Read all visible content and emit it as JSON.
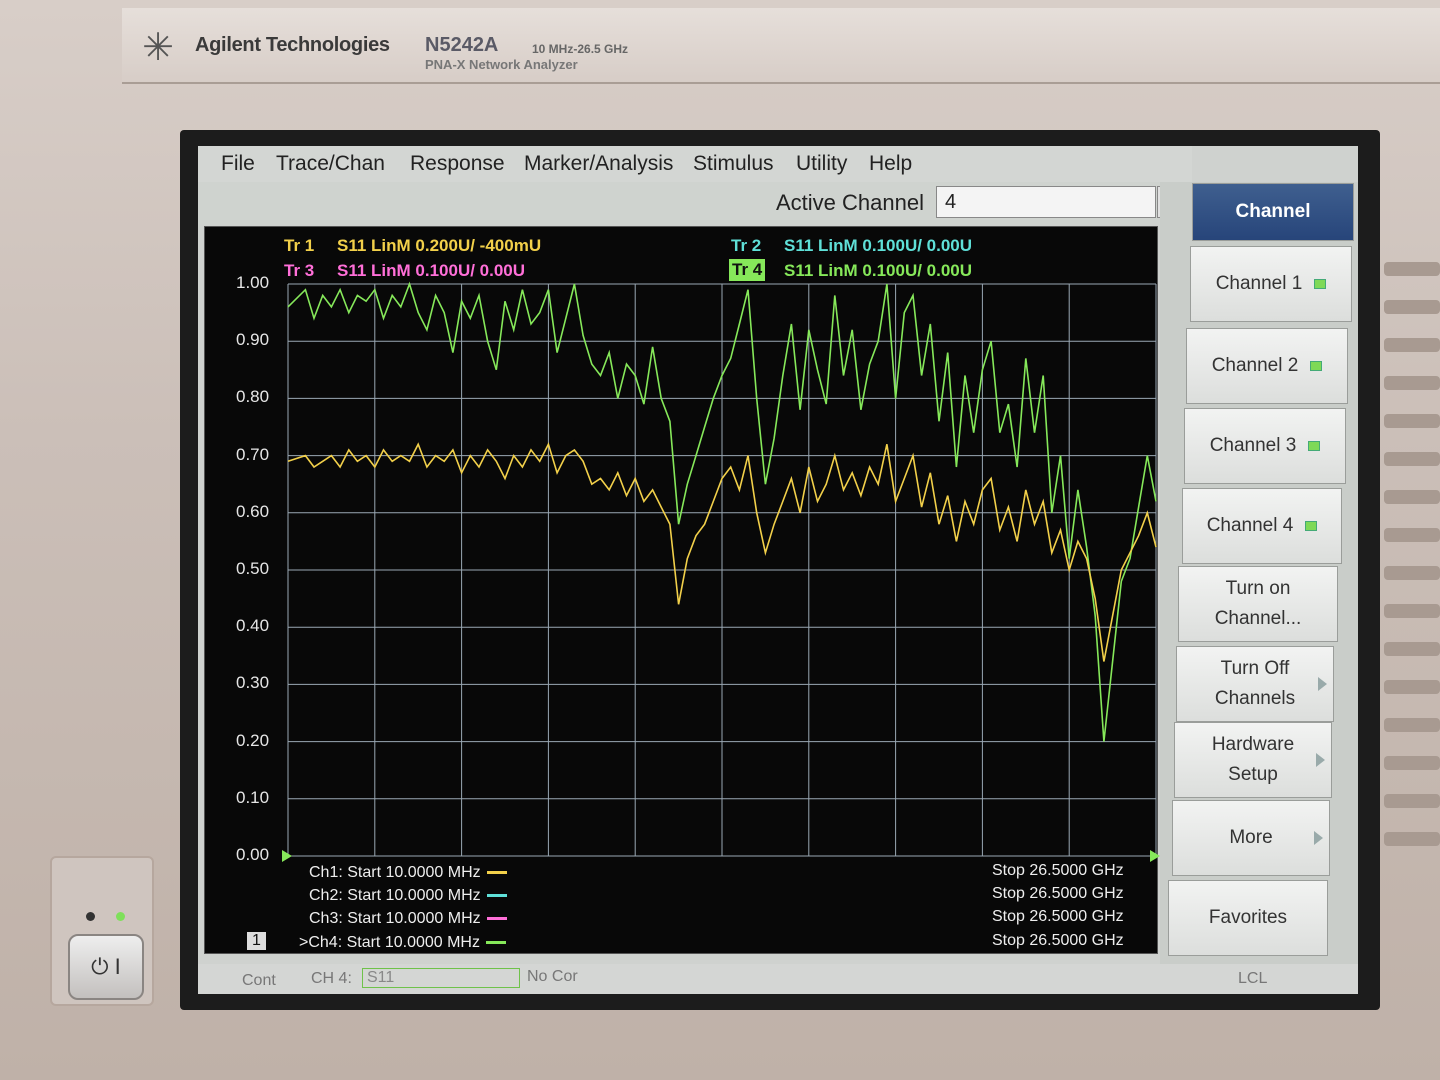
{
  "instrument": {
    "brand": "Agilent Technologies",
    "model": "N5242A",
    "freq_range": "10 MHz-26.5 GHz",
    "subtitle": "PNA-X Network Analyzer"
  },
  "menu": [
    "File",
    "Trace/Chan",
    "Response",
    "Marker/Analysis",
    "Stimulus",
    "Utility",
    "Help"
  ],
  "active_channel": {
    "label": "Active Channel",
    "value": "4"
  },
  "softkeys": {
    "header": "Channel",
    "channel1": "Channel 1",
    "channel2": "Channel 2",
    "channel3": "Channel 3",
    "channel4": "Channel 4",
    "turn_on_1": "Turn on",
    "turn_on_2": "Channel...",
    "turn_off_1": "Turn Off",
    "turn_off_2": "Channels",
    "hardware_1": "Hardware",
    "hardware_2": "Setup",
    "more": "More",
    "favorites": "Favorites"
  },
  "traces": {
    "tr1_id": "Tr 1",
    "tr1_text": "S11 LinM 0.200U/  -400mU",
    "tr2_id": "Tr 2",
    "tr2_text": "S11 LinM 0.100U/  0.00U",
    "tr3_id": "Tr 3",
    "tr3_text": "S11 LinM 0.100U/  0.00U",
    "tr4_id": "Tr 4",
    "tr4_text": "S11 LinM 0.100U/  0.00U"
  },
  "channels_info": {
    "ch1_start": "Ch1: Start  10.0000 MHz",
    "ch1_stop": "Stop  26.5000 GHz",
    "ch2_start": "Ch2: Start  10.0000 MHz",
    "ch2_stop": "Stop  26.5000 GHz",
    "ch3_start": "Ch3: Start  10.0000 MHz",
    "ch3_stop": "Stop  26.5000 GHz",
    "ch4_start": ">Ch4: Start  10.0000 MHz",
    "ch4_stop": "Stop  26.5000 GHz",
    "window_num": "1"
  },
  "status": {
    "cont": "Cont",
    "ch": "CH 4:",
    "param": "S11",
    "cor": "No Cor",
    "lcl": "LCL"
  },
  "colors": {
    "tr1": "#f2d04a",
    "tr2": "#5fe0d8",
    "tr3": "#ff6fd8",
    "tr4": "#86e85a"
  },
  "chart_data": {
    "type": "line",
    "xlabel": "",
    "ylabel": "",
    "ylim": [
      0,
      1.0
    ],
    "xlim": [
      0,
      100
    ],
    "yticks": [
      "1.00",
      "0.90",
      "0.80",
      "0.70",
      "0.60",
      "0.50",
      "0.40",
      "0.30",
      "0.20",
      "0.10",
      "0.00"
    ],
    "grid": true,
    "series": [
      {
        "name": "Tr 4",
        "x": [
          0,
          2,
          3,
          4,
          5,
          6,
          7,
          8,
          9,
          10,
          11,
          12,
          13,
          14,
          15,
          16,
          17,
          18,
          19,
          20,
          21,
          22,
          23,
          24,
          25,
          26,
          27,
          28,
          29,
          30,
          31,
          32,
          33,
          34,
          35,
          36,
          37,
          38,
          39,
          40,
          41,
          42,
          43,
          44,
          45,
          46,
          47,
          48,
          49,
          50,
          51,
          52,
          53,
          54,
          55,
          56,
          57,
          58,
          59,
          60,
          61,
          62,
          63,
          64,
          65,
          66,
          67,
          68,
          69,
          70,
          71,
          72,
          73,
          74,
          75,
          76,
          77,
          78,
          79,
          80,
          81,
          82,
          83,
          84,
          85,
          86,
          87,
          88,
          89,
          90,
          91,
          92,
          93,
          94,
          95,
          96,
          97,
          98,
          99,
          100
        ],
        "y": [
          0.96,
          0.99,
          0.94,
          0.98,
          0.96,
          0.99,
          0.95,
          0.98,
          0.97,
          0.99,
          0.94,
          0.98,
          0.96,
          1.0,
          0.95,
          0.92,
          0.98,
          0.95,
          0.88,
          0.97,
          0.94,
          0.98,
          0.9,
          0.85,
          0.97,
          0.92,
          0.99,
          0.93,
          0.95,
          0.99,
          0.88,
          0.94,
          1.0,
          0.91,
          0.86,
          0.84,
          0.88,
          0.8,
          0.86,
          0.84,
          0.79,
          0.89,
          0.8,
          0.76,
          0.58,
          0.65,
          0.7,
          0.75,
          0.8,
          0.84,
          0.87,
          0.93,
          0.99,
          0.8,
          0.65,
          0.73,
          0.84,
          0.93,
          0.78,
          0.92,
          0.85,
          0.79,
          0.98,
          0.84,
          0.92,
          0.78,
          0.86,
          0.9,
          1.0,
          0.8,
          0.95,
          0.98,
          0.84,
          0.93,
          0.76,
          0.88,
          0.68,
          0.84,
          0.74,
          0.85,
          0.9,
          0.74,
          0.79,
          0.68,
          0.87,
          0.74,
          0.84,
          0.6,
          0.7,
          0.52,
          0.64,
          0.54,
          0.42,
          0.2,
          0.34,
          0.48,
          0.52,
          0.61,
          0.7,
          0.62
        ]
      },
      {
        "name": "Tr 1",
        "x": [
          0,
          2,
          3,
          4,
          5,
          6,
          7,
          8,
          9,
          10,
          11,
          12,
          13,
          14,
          15,
          16,
          17,
          18,
          19,
          20,
          21,
          22,
          23,
          24,
          25,
          26,
          27,
          28,
          29,
          30,
          31,
          32,
          33,
          34,
          35,
          36,
          37,
          38,
          39,
          40,
          41,
          42,
          43,
          44,
          45,
          46,
          47,
          48,
          49,
          50,
          51,
          52,
          53,
          54,
          55,
          56,
          57,
          58,
          59,
          60,
          61,
          62,
          63,
          64,
          65,
          66,
          67,
          68,
          69,
          70,
          71,
          72,
          73,
          74,
          75,
          76,
          77,
          78,
          79,
          80,
          81,
          82,
          83,
          84,
          85,
          86,
          87,
          88,
          89,
          90,
          91,
          92,
          93,
          94,
          95,
          96,
          97,
          98,
          99,
          100
        ],
        "y": [
          0.69,
          0.7,
          0.68,
          0.69,
          0.7,
          0.68,
          0.71,
          0.69,
          0.7,
          0.68,
          0.71,
          0.69,
          0.7,
          0.69,
          0.72,
          0.68,
          0.7,
          0.69,
          0.71,
          0.67,
          0.7,
          0.68,
          0.71,
          0.69,
          0.66,
          0.7,
          0.68,
          0.71,
          0.69,
          0.72,
          0.67,
          0.7,
          0.71,
          0.69,
          0.65,
          0.66,
          0.64,
          0.67,
          0.63,
          0.66,
          0.62,
          0.64,
          0.61,
          0.58,
          0.44,
          0.52,
          0.56,
          0.58,
          0.62,
          0.66,
          0.68,
          0.64,
          0.7,
          0.6,
          0.53,
          0.58,
          0.62,
          0.66,
          0.6,
          0.68,
          0.62,
          0.65,
          0.7,
          0.64,
          0.67,
          0.63,
          0.68,
          0.65,
          0.72,
          0.62,
          0.66,
          0.7,
          0.61,
          0.67,
          0.58,
          0.63,
          0.55,
          0.62,
          0.58,
          0.64,
          0.66,
          0.57,
          0.61,
          0.55,
          0.64,
          0.58,
          0.62,
          0.53,
          0.57,
          0.5,
          0.55,
          0.52,
          0.45,
          0.34,
          0.42,
          0.5,
          0.53,
          0.56,
          0.6,
          0.54
        ]
      }
    ]
  }
}
